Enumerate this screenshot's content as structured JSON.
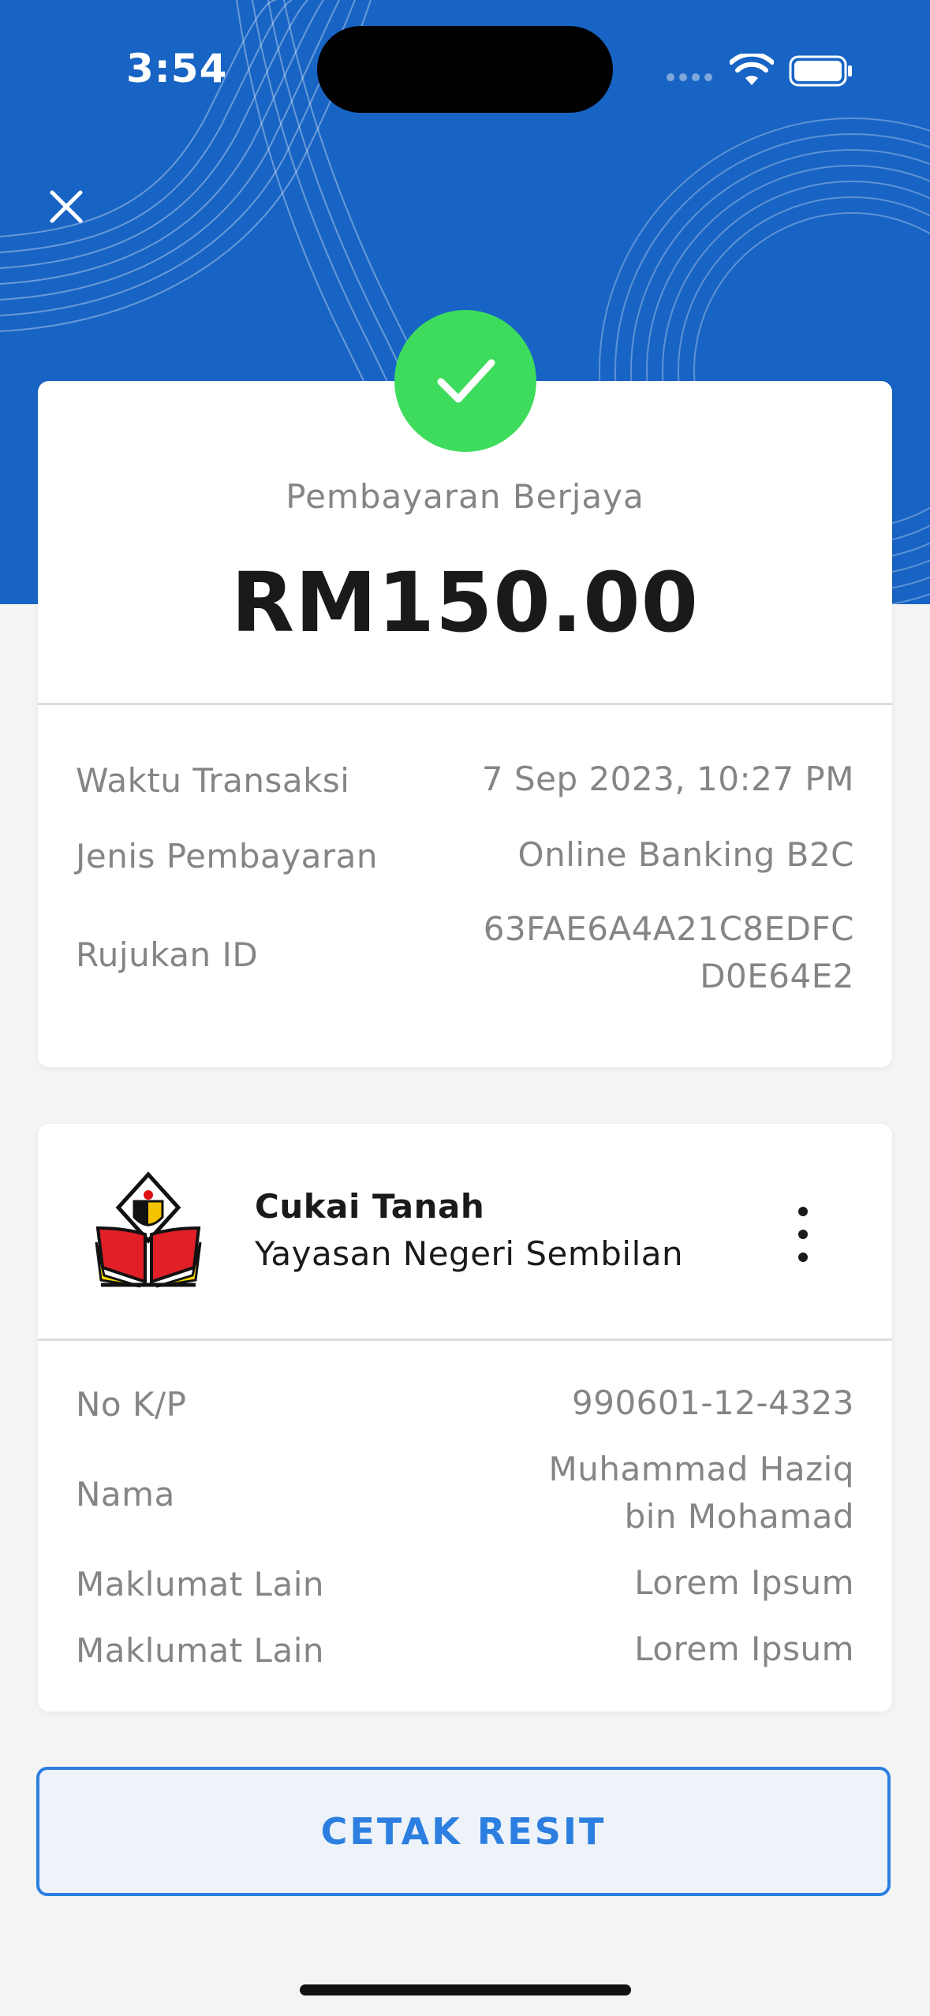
{
  "status_bar": {
    "time": "3:54"
  },
  "payment": {
    "status": "Pembayaran Berjaya",
    "amount": "RM150.00"
  },
  "transaction": {
    "rows": [
      {
        "label": "Waktu Transaksi",
        "value": "7 Sep 2023, 10:27 PM"
      },
      {
        "label": "Jenis Pembayaran",
        "value": "Online Banking B2C"
      },
      {
        "label": "Rujukan ID",
        "value_line1": "63FAE6A4A21C8EDFC",
        "value_line2": "D0E64E2"
      }
    ]
  },
  "biller": {
    "title": "Cukai Tanah",
    "subtitle": "Yayasan Negeri Sembilan",
    "rows": [
      {
        "label": "No K/P",
        "value": "990601-12-4323"
      },
      {
        "label": "Nama",
        "value_line1": "Muhammad Haziq",
        "value_line2": "bin Mohamad"
      },
      {
        "label": "Maklumat Lain",
        "value": "Lorem Ipsum"
      },
      {
        "label": "Maklumat Lain",
        "value": "Lorem Ipsum"
      }
    ]
  },
  "actions": {
    "print_label": "CETAK RESIT"
  },
  "colors": {
    "header_blue": "#1864c4",
    "success_green": "#3ddc5c",
    "accent_blue": "#2c7fe0"
  },
  "icons": [
    "close-icon",
    "checkmark-icon",
    "wifi-icon",
    "battery-icon",
    "more-vertical-icon",
    "yayasan-logo"
  ]
}
